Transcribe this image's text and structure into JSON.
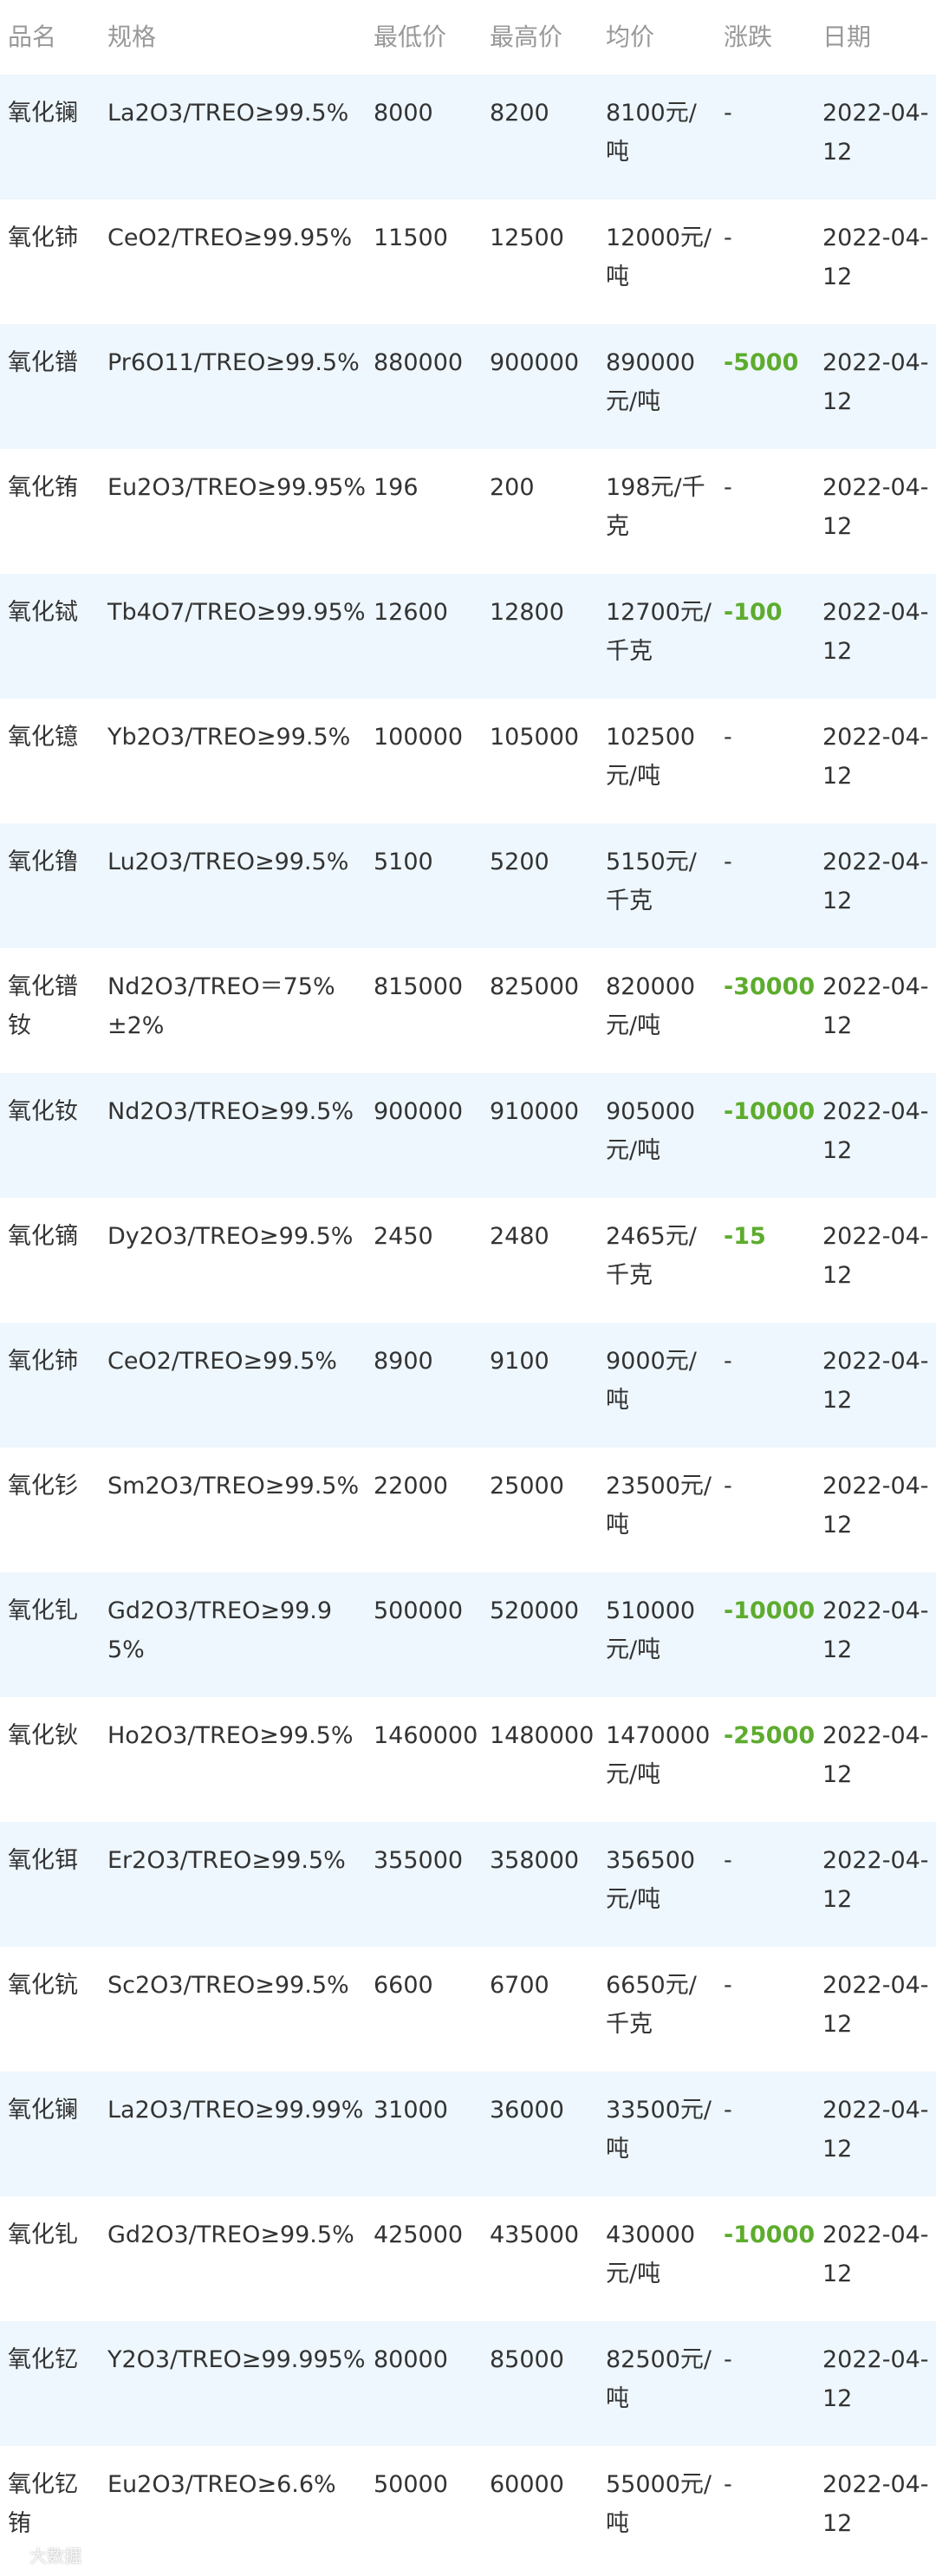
{
  "table": {
    "headers": [
      "品名",
      "规格",
      "最低价",
      "最高价",
      "均价",
      "涨跌",
      "日期"
    ],
    "rows": [
      {
        "name": "氧化镧",
        "spec": "La2O3/TREO≥99.5%",
        "low": "8000",
        "high": "8200",
        "avg": "8100元/吨",
        "change": "-",
        "date": "2022-04-12"
      },
      {
        "name": "氧化铈",
        "spec": "CeO2/TREO≥99.95%",
        "low": "11500",
        "high": "12500",
        "avg": "12000元/吨",
        "change": "-",
        "date": "2022-04-12"
      },
      {
        "name": "氧化镨",
        "spec": "Pr6O11/TREO≥99.5%",
        "low": "880000",
        "high": "900000",
        "avg": "890000元/吨",
        "change": "-5000",
        "date": "2022-04-12"
      },
      {
        "name": "氧化铕",
        "spec": "Eu2O3/TREO≥99.95%",
        "low": "196",
        "high": "200",
        "avg": "198元/千克",
        "change": "-",
        "date": "2022-04-12"
      },
      {
        "name": "氧化铽",
        "spec": "Tb4O7/TREO≥99.95%",
        "low": "12600",
        "high": "12800",
        "avg": "12700元/千克",
        "change": "-100",
        "date": "2022-04-12"
      },
      {
        "name": "氧化镱",
        "spec": "Yb2O3/TREO≥99.5%",
        "low": "100000",
        "high": "105000",
        "avg": "102500元/吨",
        "change": "-",
        "date": "2022-04-12"
      },
      {
        "name": "氧化镥",
        "spec": "Lu2O3/TREO≥99.5%",
        "low": "5100",
        "high": "5200",
        "avg": "5150元/千克",
        "change": "-",
        "date": "2022-04-12"
      },
      {
        "name": "氧化镨钕",
        "spec": "Nd2O3/TREO＝75%±2%",
        "low": "815000",
        "high": "825000",
        "avg": "820000元/吨",
        "change": "-30000",
        "date": "2022-04-12"
      },
      {
        "name": "氧化钕",
        "spec": "Nd2O3/TREO≥99.5%",
        "low": "900000",
        "high": "910000",
        "avg": "905000元/吨",
        "change": "-10000",
        "date": "2022-04-12"
      },
      {
        "name": "氧化镝",
        "spec": "Dy2O3/TREO≥99.5%",
        "low": "2450",
        "high": "2480",
        "avg": "2465元/千克",
        "change": "-15",
        "date": "2022-04-12"
      },
      {
        "name": "氧化铈",
        "spec": "CeO2/TREO≥99.5%",
        "low": "8900",
        "high": "9100",
        "avg": "9000元/吨",
        "change": "-",
        "date": "2022-04-12"
      },
      {
        "name": "氧化钐",
        "spec": "Sm2O3/TREO≥99.5%",
        "low": "22000",
        "high": "25000",
        "avg": "23500元/吨",
        "change": "-",
        "date": "2022-04-12"
      },
      {
        "name": "氧化钆",
        "spec": "Gd2O3/TREO≥99.95%",
        "low": "500000",
        "high": "520000",
        "avg": "510000元/吨",
        "change": "-10000",
        "date": "2022-04-12"
      },
      {
        "name": "氧化钬",
        "spec": "Ho2O3/TREO≥99.5%",
        "low": "1460000",
        "high": "1480000",
        "avg": "1470000元/吨",
        "change": "-25000",
        "date": "2022-04-12"
      },
      {
        "name": "氧化铒",
        "spec": "Er2O3/TREO≥99.5%",
        "low": "355000",
        "high": "358000",
        "avg": "356500元/吨",
        "change": "-",
        "date": "2022-04-12"
      },
      {
        "name": "氧化钪",
        "spec": "Sc2O3/TREO≥99.5%",
        "low": "6600",
        "high": "6700",
        "avg": "6650元/千克",
        "change": "-",
        "date": "2022-04-12"
      },
      {
        "name": "氧化镧",
        "spec": "La2O3/TREO≥99.99%",
        "low": "31000",
        "high": "36000",
        "avg": "33500元/吨",
        "change": "-",
        "date": "2022-04-12"
      },
      {
        "name": "氧化钆",
        "spec": "Gd2O3/TREO≥99.5%",
        "low": "425000",
        "high": "435000",
        "avg": "430000元/吨",
        "change": "-10000",
        "date": "2022-04-12"
      },
      {
        "name": "氧化钇",
        "spec": "Y2O3/TREO≥99.995%",
        "low": "80000",
        "high": "85000",
        "avg": "82500元/吨",
        "change": "-",
        "date": "2022-04-12"
      },
      {
        "name": "氧化钇铕",
        "spec": "Eu2O3/TREO≥6.6%",
        "low": "50000",
        "high": "60000",
        "avg": "55000元/吨",
        "change": "-",
        "date": "2022-04-12"
      }
    ]
  },
  "colors": {
    "row_alt": "#eef7fd",
    "header_text": "#999999",
    "body_text": "#333333",
    "change_down": "#5dac2e"
  },
  "watermark": {
    "icon": "watermark-logo-icon",
    "text": "大数据"
  }
}
